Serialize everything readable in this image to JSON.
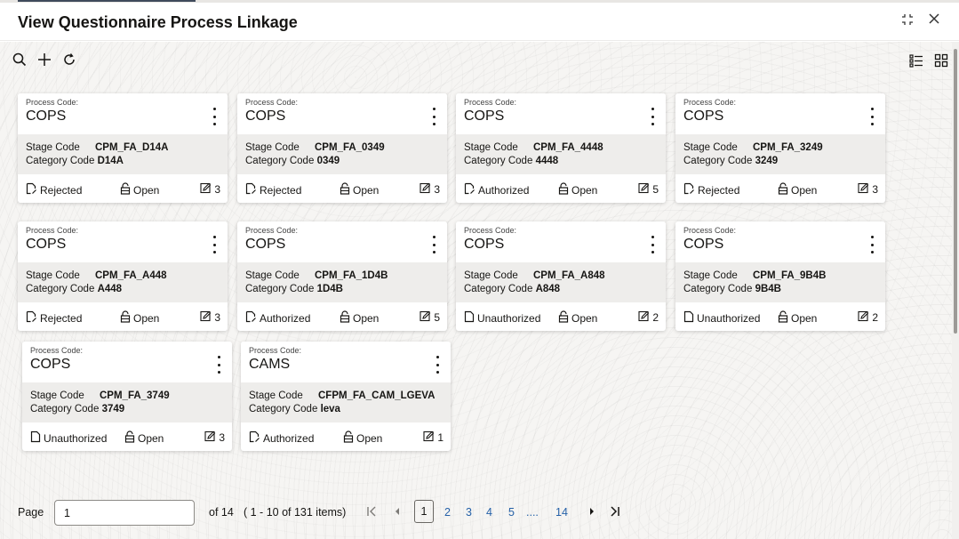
{
  "window": {
    "title": "View Questionnaire Process Linkage",
    "restore_glyph": "⛶",
    "close_glyph": "✕"
  },
  "toolbar": {
    "left_icons": [
      "search-icon",
      "add-icon",
      "refresh-icon"
    ],
    "right_icons": [
      "list-view-icon",
      "grid-view-icon"
    ]
  },
  "card_labels": {
    "process_code": "Process Code:",
    "stage_code": "Stage Code",
    "category_code": "Category Code",
    "open": "Open"
  },
  "cards": [
    {
      "process_code": "COPS",
      "stage_code": "CPM_FA_D14A",
      "category_code": "D14A",
      "status": "Rejected",
      "open": "Open",
      "count": "3"
    },
    {
      "process_code": "COPS",
      "stage_code": "CPM_FA_0349",
      "category_code": "0349",
      "status": "Rejected",
      "open": "Open",
      "count": "3"
    },
    {
      "process_code": "COPS",
      "stage_code": "CPM_FA_4448",
      "category_code": "4448",
      "status": "Authorized",
      "open": "Open",
      "count": "5"
    },
    {
      "process_code": "COPS",
      "stage_code": "CPM_FA_3249",
      "category_code": "3249",
      "status": "Rejected",
      "open": "Open",
      "count": "3"
    },
    {
      "process_code": "COPS",
      "stage_code": "CPM_FA_A448",
      "category_code": "A448",
      "status": "Rejected",
      "open": "Open",
      "count": "3"
    },
    {
      "process_code": "COPS",
      "stage_code": "CPM_FA_1D4B",
      "category_code": "1D4B",
      "status": "Authorized",
      "open": "Open",
      "count": "5"
    },
    {
      "process_code": "COPS",
      "stage_code": "CPM_FA_A848",
      "category_code": "A848",
      "status": "Unauthorized",
      "open": "Open",
      "count": "2"
    },
    {
      "process_code": "COPS",
      "stage_code": "CPM_FA_9B4B",
      "category_code": "9B4B",
      "status": "Unauthorized",
      "open": "Open",
      "count": "2"
    },
    {
      "process_code": "COPS",
      "stage_code": "CPM_FA_3749",
      "category_code": "3749",
      "status": "Unauthorized",
      "open": "Open",
      "count": "3"
    },
    {
      "process_code": "CAMS",
      "stage_code": "CFPM_FA_CAM_LGEVA",
      "category_code": "leva",
      "status": "Authorized",
      "open": "Open",
      "count": "1"
    }
  ],
  "pagination": {
    "page_label": "Page",
    "page_value": "1",
    "of_text": "of 14",
    "items_text": "( 1 - 10 of 131 items)",
    "current_page": "1",
    "pages": [
      "2",
      "3",
      "4",
      "5"
    ],
    "ellipsis": "....",
    "last_page": "14"
  },
  "colors": {
    "link": "#2561a8",
    "card_mid": "#eeedeb",
    "background": "#f6f5f3"
  }
}
